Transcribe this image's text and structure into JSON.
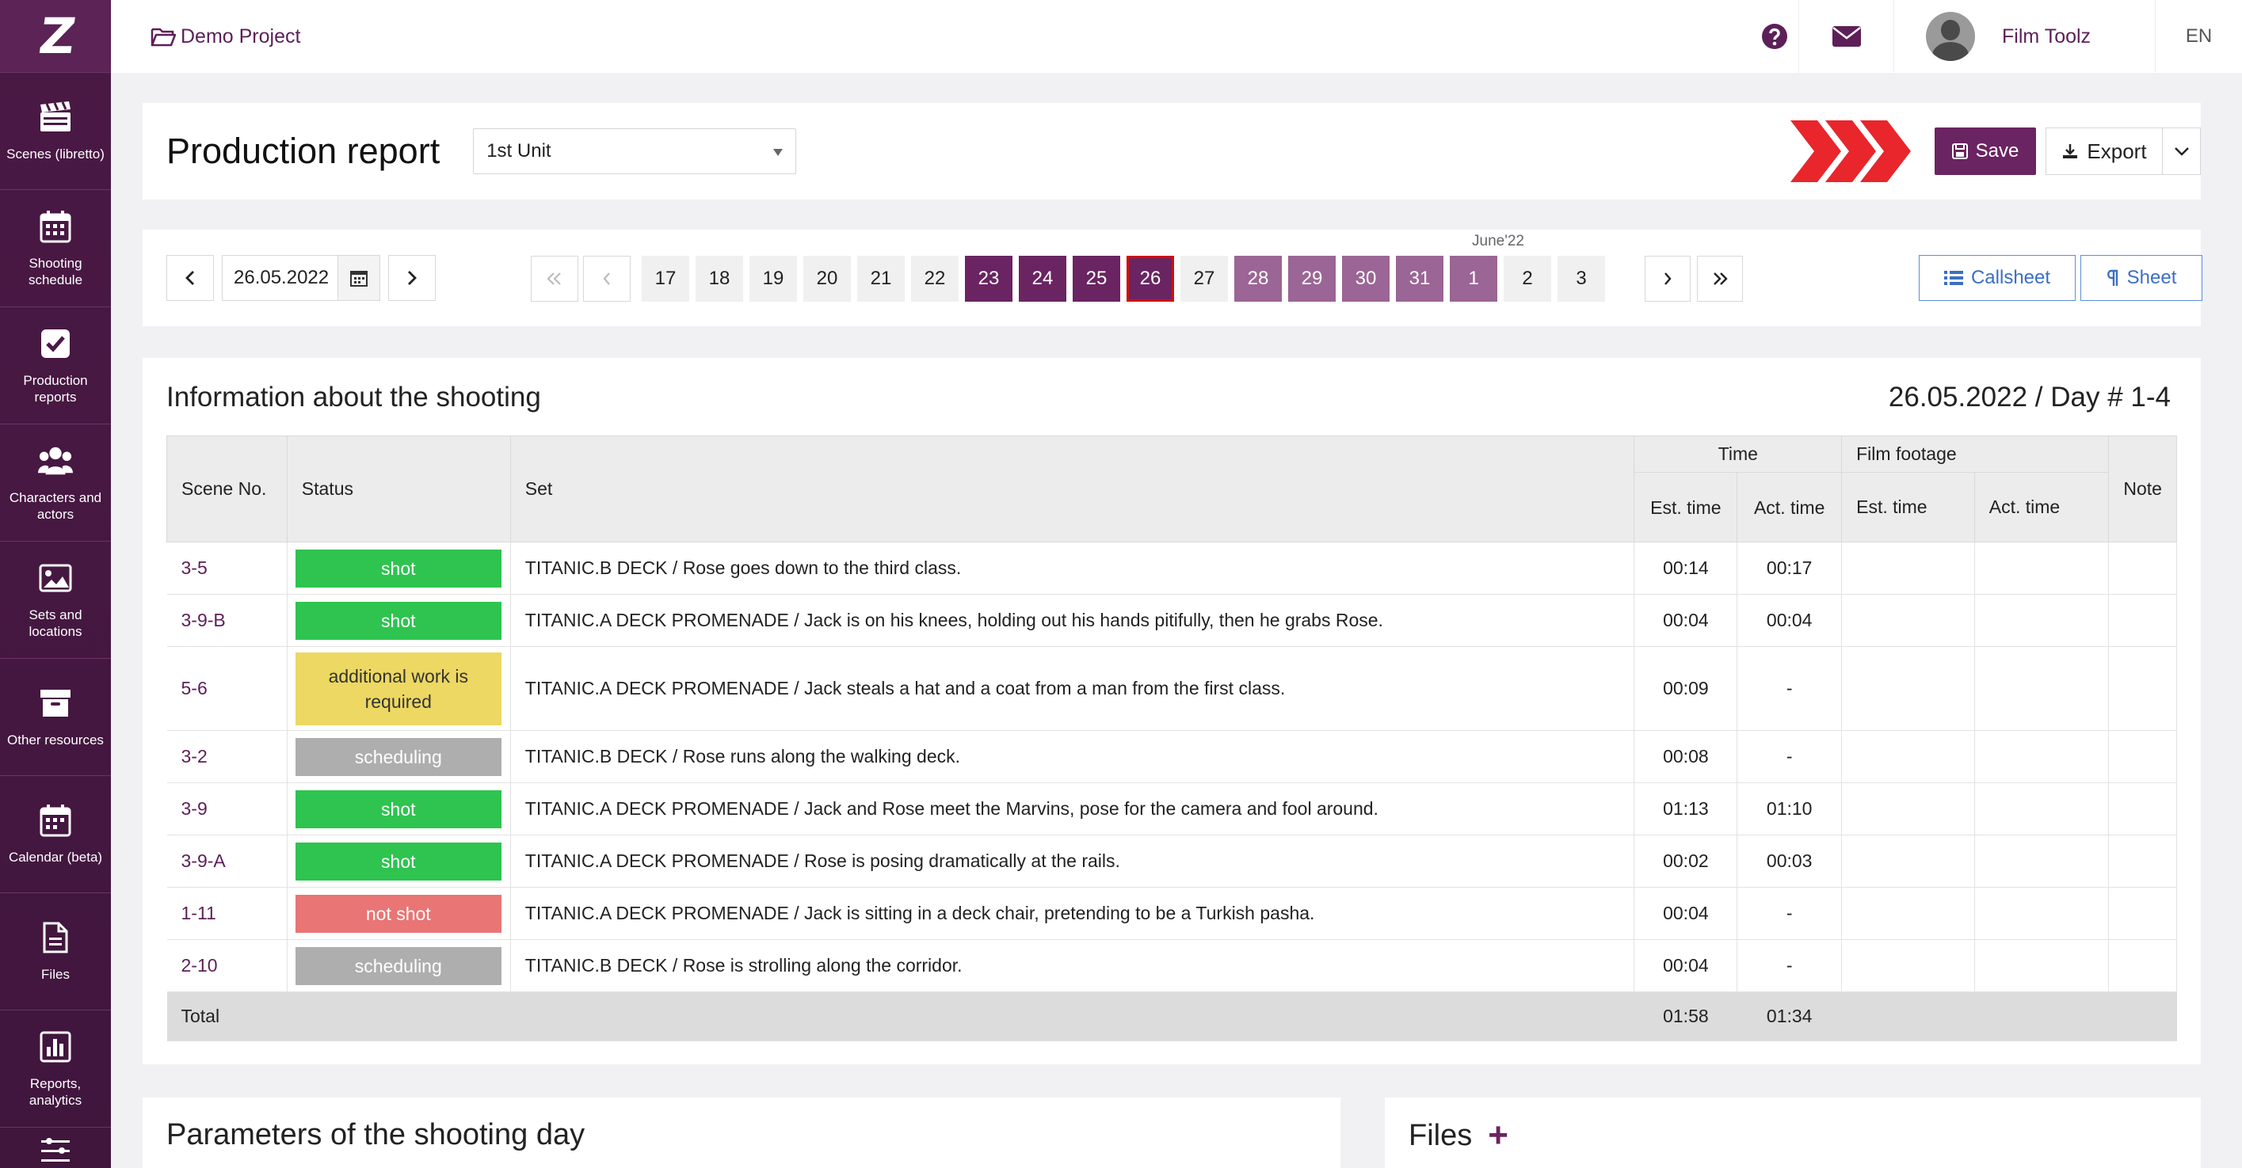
{
  "sidebar": {
    "items": [
      {
        "label": "Scenes (libretto)",
        "icon": "clapperboard-icon"
      },
      {
        "label": "Shooting schedule",
        "icon": "calendar-grid-icon"
      },
      {
        "label": "Production reports",
        "icon": "checkbox-icon"
      },
      {
        "label": "Characters and actors",
        "icon": "people-icon"
      },
      {
        "label": "Sets and locations",
        "icon": "image-icon"
      },
      {
        "label": "Other resources",
        "icon": "archive-box-icon"
      },
      {
        "label": "Calendar (beta)",
        "icon": "calendar-icon"
      },
      {
        "label": "Files",
        "icon": "file-icon"
      },
      {
        "label": "Reports, analytics",
        "icon": "bar-chart-icon"
      }
    ]
  },
  "topbar": {
    "project": "Demo Project",
    "user": "Film Toolz",
    "lang": "EN"
  },
  "header": {
    "title": "Production report",
    "unit": "1st Unit",
    "save": "Save",
    "export": "Export"
  },
  "dates": {
    "current": "26.05.2022",
    "month_label": "June'22",
    "days": [
      {
        "d": "17",
        "state": "plain"
      },
      {
        "d": "18",
        "state": "plain"
      },
      {
        "d": "19",
        "state": "plain"
      },
      {
        "d": "20",
        "state": "plain"
      },
      {
        "d": "21",
        "state": "plain"
      },
      {
        "d": "22",
        "state": "plain"
      },
      {
        "d": "23",
        "state": "shoot"
      },
      {
        "d": "24",
        "state": "shoot"
      },
      {
        "d": "25",
        "state": "shoot"
      },
      {
        "d": "26",
        "state": "sel"
      },
      {
        "d": "27",
        "state": "plain"
      },
      {
        "d": "28",
        "state": "future"
      },
      {
        "d": "29",
        "state": "future"
      },
      {
        "d": "30",
        "state": "future"
      },
      {
        "d": "31",
        "state": "future"
      },
      {
        "d": "1",
        "state": "future"
      },
      {
        "d": "2",
        "state": "plain"
      },
      {
        "d": "3",
        "state": "plain"
      }
    ],
    "callsheet": "Callsheet",
    "sheet": "Sheet"
  },
  "info": {
    "title": "Information about the shooting",
    "day": "26.05.2022 / Day # 1-4",
    "headers": {
      "scene": "Scene No.",
      "status": "Status",
      "set": "Set",
      "time": "Time",
      "footage": "Film footage",
      "note": "Note",
      "est_time": "Est. time",
      "act_time": "Act. time",
      "fest_time": "Est. time",
      "fact_time": "Act. time"
    },
    "rows": [
      {
        "scene": "3-5",
        "status": "shot",
        "kind": "shot",
        "set": "TITANIC.B DECK / Rose goes down to the third class.",
        "est": "00:14",
        "act": "00:17"
      },
      {
        "scene": "3-9-B",
        "status": "shot",
        "kind": "shot",
        "set": "TITANIC.A DECK PROMENADE / Jack is on his knees, holding out his hands pitifully, then he grabs Rose.",
        "est": "00:04",
        "act": "00:04"
      },
      {
        "scene": "5-6",
        "status": "additional work is required",
        "kind": "additional",
        "set": "TITANIC.A DECK PROMENADE / Jack steals a hat and a coat from a man from the first class.",
        "est": "00:09",
        "act": "-"
      },
      {
        "scene": "3-2",
        "status": "scheduling",
        "kind": "scheduling",
        "set": "TITANIC.B DECK / Rose runs along the walking deck.",
        "est": "00:08",
        "act": "-"
      },
      {
        "scene": "3-9",
        "status": "shot",
        "kind": "shot",
        "set": "TITANIC.A DECK PROMENADE / Jack and Rose meet the Marvins, pose for the camera and fool around.",
        "est": "01:13",
        "act": "01:10"
      },
      {
        "scene": "3-9-A",
        "status": "shot",
        "kind": "shot",
        "set": "TITANIC.A DECK PROMENADE / Rose is posing dramatically at the rails.",
        "est": "00:02",
        "act": "00:03"
      },
      {
        "scene": "1-11",
        "status": "not shot",
        "kind": "notshot",
        "set": "TITANIC.A DECK PROMENADE / Jack is sitting in a deck chair, pretending to be a Turkish pasha.",
        "est": "00:04",
        "act": "-"
      },
      {
        "scene": "2-10",
        "status": "scheduling",
        "kind": "scheduling",
        "set": "TITANIC.B DECK / Rose is strolling along the corridor.",
        "est": "00:04",
        "act": "-"
      }
    ],
    "total": {
      "label": "Total",
      "est": "01:58",
      "act": "01:34"
    }
  },
  "params": {
    "title": "Parameters of the shooting day"
  },
  "files": {
    "title": "Files",
    "add": "+"
  },
  "colors": {
    "brand": "#6a2462",
    "sidebar": "#4a1945",
    "shot": "#2ec44f",
    "additional": "#ecd862",
    "scheduling": "#aeaeae",
    "notshot": "#e97575",
    "blue": "#3a6fc4"
  }
}
